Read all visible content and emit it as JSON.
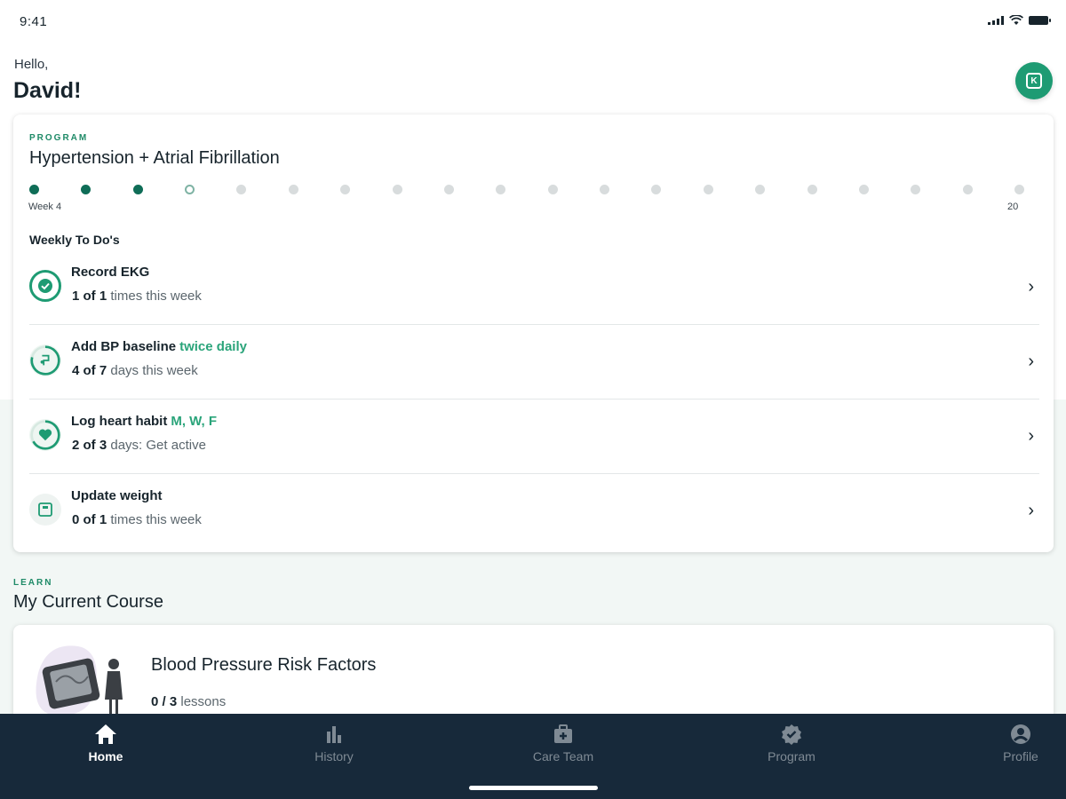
{
  "status_bar": {
    "time": "9:41"
  },
  "greeting": {
    "hello": "Hello,",
    "name": "David!",
    "avatar_initial": "K"
  },
  "program": {
    "eyebrow": "PROGRAM",
    "title": "Hypertension + Atrial Fibrillation",
    "total_weeks": 20,
    "completed_weeks": 3,
    "current_week": 4,
    "week_label": "Week 4",
    "end_label": "20",
    "todo_heading": "Weekly To Do's",
    "todos": [
      {
        "title": "Record EKG",
        "accent": "",
        "count": "1 of 1",
        "suffix": "times this week",
        "icon": "check-circle-icon",
        "state": "complete"
      },
      {
        "title": "Add BP baseline",
        "accent": "twice daily",
        "count": "4 of 7",
        "suffix": "days this week",
        "icon": "blood-pressure-icon",
        "state": "partial"
      },
      {
        "title": "Log heart habit",
        "accent": "M, W, F",
        "count": "2 of 3",
        "suffix": "days: Get active",
        "icon": "heart-icon",
        "state": "partial"
      },
      {
        "title": "Update weight",
        "accent": "",
        "count": "0 of 1",
        "suffix": "times this week",
        "icon": "scale-icon",
        "state": "empty"
      }
    ]
  },
  "learn": {
    "eyebrow": "LEARN",
    "title": "My Current Course",
    "course": {
      "title": "Blood Pressure Risk Factors",
      "count": "0 / 3",
      "suffix": "lessons"
    }
  },
  "tabs": [
    {
      "label": "Home",
      "icon": "home-icon",
      "active": true
    },
    {
      "label": "History",
      "icon": "bar-chart-icon",
      "active": false
    },
    {
      "label": "Care Team",
      "icon": "medical-bag-icon",
      "active": false
    },
    {
      "label": "Program",
      "icon": "verified-check-icon",
      "active": false
    },
    {
      "label": "Profile",
      "icon": "person-circle-icon",
      "active": false
    }
  ],
  "colors": {
    "accent": "#1e9b73",
    "dark_green": "#0f6d57",
    "tab_bar": "#17293a",
    "text": "#17242c"
  }
}
